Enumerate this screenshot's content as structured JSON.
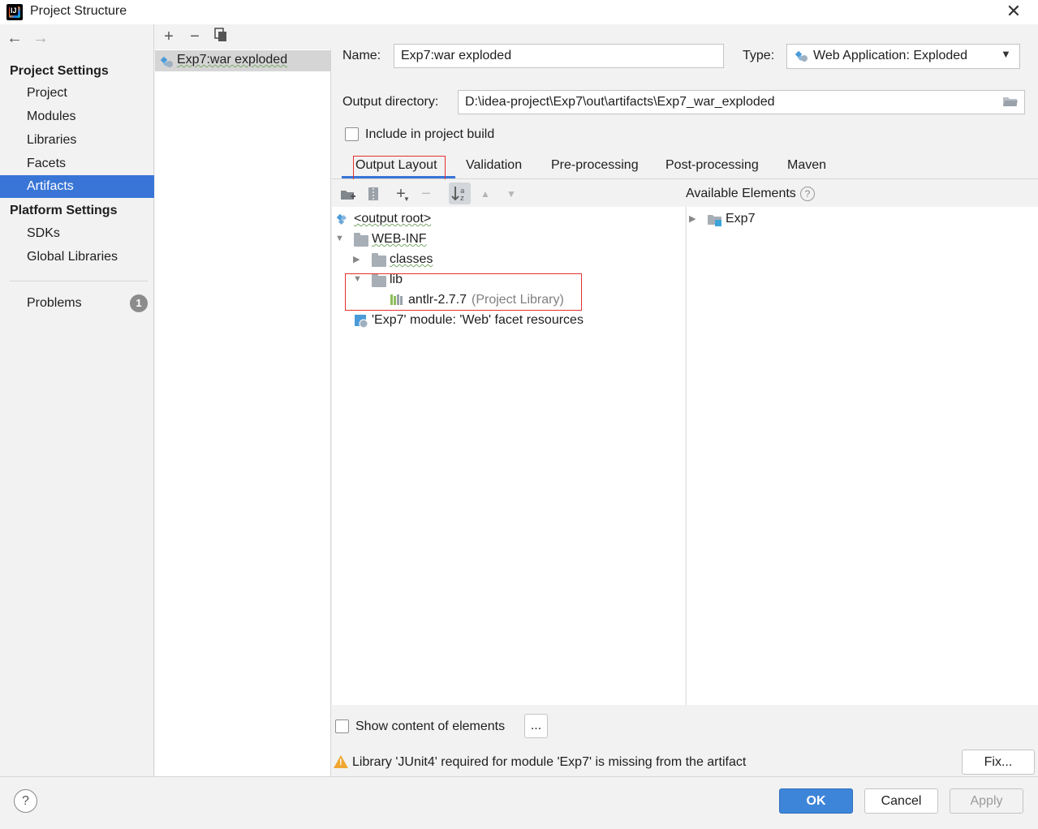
{
  "window": {
    "title": "Project Structure"
  },
  "sidebar": {
    "project_settings_heading": "Project Settings",
    "project_items": [
      "Project",
      "Modules",
      "Libraries",
      "Facets",
      "Artifacts"
    ],
    "platform_settings_heading": "Platform Settings",
    "platform_items": [
      "SDKs",
      "Global Libraries"
    ],
    "problems_label": "Problems",
    "problems_count": "1",
    "selected": "Artifacts"
  },
  "artifacts": {
    "items": [
      "Exp7:war exploded"
    ]
  },
  "form": {
    "name_label": "Name:",
    "name_value": "Exp7:war exploded",
    "type_label": "Type:",
    "type_value": "Web Application: Exploded",
    "output_dir_label": "Output directory:",
    "output_dir_value": "D:\\idea-project\\Exp7\\out\\artifacts\\Exp7_war_exploded",
    "include_build_label": "Include in project build",
    "include_build_checked": false
  },
  "tabs": [
    "Output Layout",
    "Validation",
    "Pre-processing",
    "Post-processing",
    "Maven"
  ],
  "active_tab": "Output Layout",
  "layout_tree": {
    "output_root": "<output root>",
    "web_inf": "WEB-INF",
    "classes": "classes",
    "lib": "lib",
    "lib_item": "antlr-2.7.7",
    "lib_item_note": "(Project Library)",
    "facet_resources": "'Exp7' module: 'Web' facet resources"
  },
  "available": {
    "header": "Available Elements",
    "help_glyph": "?",
    "items": [
      "Exp7"
    ]
  },
  "bottom": {
    "show_content_label": "Show content of elements",
    "show_content_checked": false,
    "ellipsis_button": "...",
    "warning_text": "Library 'JUnit4' required for module 'Exp7' is missing from the artifact",
    "fix_button": "Fix..."
  },
  "footer": {
    "help_glyph": "?",
    "ok": "OK",
    "cancel": "Cancel",
    "apply": "Apply"
  },
  "colors": {
    "accent": "#3875d7",
    "ok_button": "#3d85d8",
    "highlight_box": "#e53030",
    "warning": "#f0a732"
  }
}
